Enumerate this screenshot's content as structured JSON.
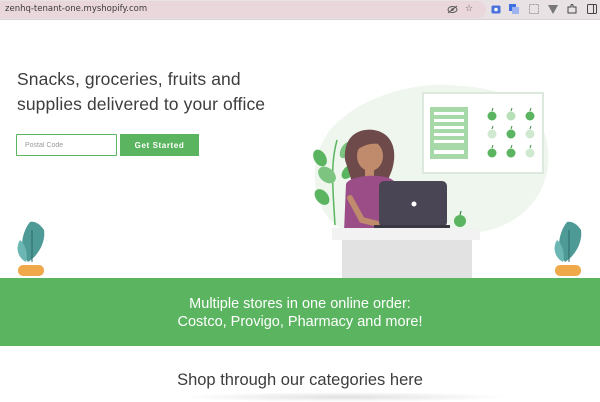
{
  "browser": {
    "url": "zenhq-tenant-one.myshopify.com",
    "icons": [
      "eye-slash-icon",
      "star-icon",
      "extension-icon",
      "translate-icon",
      "extension-icon",
      "filter-icon",
      "puzzle-icon",
      "sidebar-icon"
    ]
  },
  "hero": {
    "headline_line1": "Snacks, groceries, fruits and",
    "headline_line2": "supplies delivered to your office",
    "postal_placeholder": "Postal Code",
    "cta_label": "Get Started"
  },
  "band": {
    "line1": "Multiple stores in one online order:",
    "line2": "Costco, Provigo, Pharmacy and more!"
  },
  "categories": {
    "title": "Shop through our categories here"
  },
  "colors": {
    "brand_green": "#5bb560",
    "text_dark": "#3d3d3d"
  }
}
